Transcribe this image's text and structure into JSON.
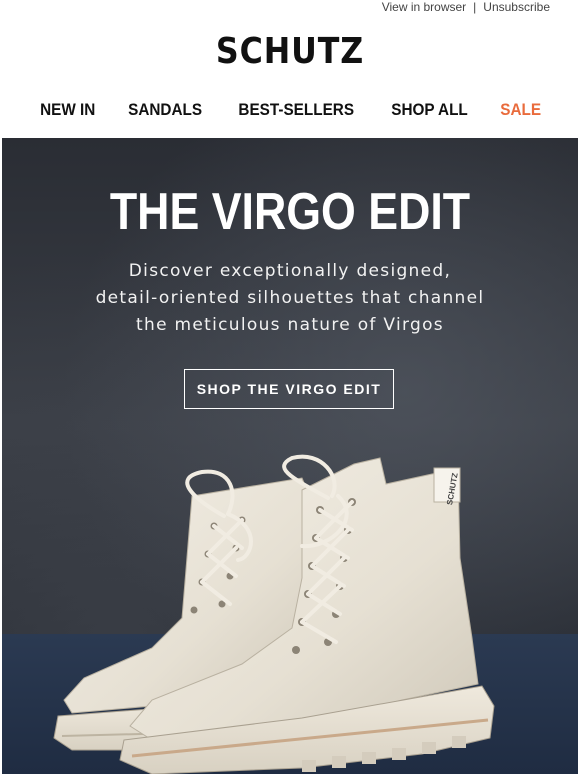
{
  "topbar": {
    "view_in_browser": "View in browser",
    "separator": "|",
    "unsubscribe": "Unsubscribe"
  },
  "brand": {
    "logo": "SCHUTZ"
  },
  "nav": {
    "items": [
      {
        "label": "NEW IN"
      },
      {
        "label": "SANDALS"
      },
      {
        "label": "BEST-SELLERS"
      },
      {
        "label": "SHOP ALL"
      },
      {
        "label": "SALE"
      }
    ],
    "sale_color": "#e96b3c"
  },
  "hero": {
    "headline": "THE VIRGO EDIT",
    "sub_lines": [
      "Discover exceptionally designed,",
      "detail-oriented silhouettes that channel",
      "the meticulous nature of Virgos"
    ],
    "cta_label": "SHOP THE VIRGO EDIT",
    "image_alt": "cream leather lace-up combat boots",
    "boot_tab_text": "SCHUTZ"
  }
}
